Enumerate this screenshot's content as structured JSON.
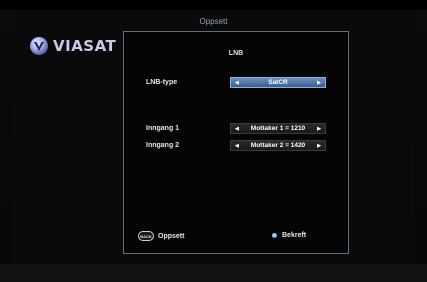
{
  "brand": {
    "name": "VIASAT"
  },
  "header": {
    "title": "Oppsett"
  },
  "panel": {
    "title": "LNB",
    "lnb_type": {
      "label": "LNB-type",
      "value": "SatCR"
    },
    "inputs": [
      {
        "label": "Inngang 1",
        "value": "Mottaker 1 = 1210"
      },
      {
        "label": "Inngang 2",
        "value": "Mottaker 2 = 1420"
      }
    ]
  },
  "footer": {
    "back_button_text": "BACK",
    "back_label": "Oppsett",
    "confirm_label": "Bekreft"
  },
  "colors": {
    "accent_blue": "#4a6fa5",
    "panel_border": "#56708a",
    "confirm_dot": "#2f8fd8"
  },
  "icons": [
    "viasat-logo-icon",
    "left-arrow-icon",
    "right-arrow-icon",
    "back-button-icon",
    "blue-dot-icon"
  ]
}
